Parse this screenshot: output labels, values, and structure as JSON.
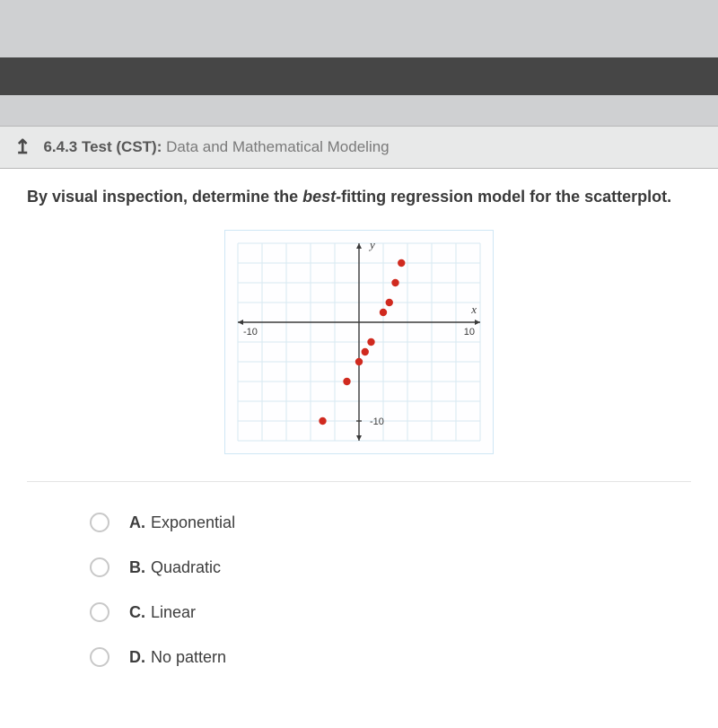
{
  "header": {
    "back_icon": "↥",
    "title_bold": "6.4.3  Test (CST):",
    "title_rest": "Data and Mathematical Modeling"
  },
  "question": {
    "prefix": "By visual inspection, determine the ",
    "emph": "best-",
    "suffix": "fitting regression model for the scatterplot."
  },
  "answers": [
    {
      "letter": "A.",
      "text": "Exponential"
    },
    {
      "letter": "B.",
      "text": "Quadratic"
    },
    {
      "letter": "C.",
      "text": "Linear"
    },
    {
      "letter": "D.",
      "text": "No pattern"
    }
  ],
  "chart_data": {
    "type": "scatter",
    "title": "",
    "xlabel": "x",
    "ylabel": "y",
    "xlim": [
      -10,
      10
    ],
    "ylim": [
      -12,
      8
    ],
    "x_ticks": [
      -10,
      10
    ],
    "y_ticks": [
      -10
    ],
    "grid": true,
    "points": [
      {
        "x": -3,
        "y": -10
      },
      {
        "x": -1,
        "y": -6
      },
      {
        "x": 0,
        "y": -4
      },
      {
        "x": 0.5,
        "y": -3
      },
      {
        "x": 1,
        "y": -2
      },
      {
        "x": 2,
        "y": 1
      },
      {
        "x": 2.5,
        "y": 2
      },
      {
        "x": 3,
        "y": 4
      },
      {
        "x": 3.5,
        "y": 6
      }
    ],
    "point_color": "#d02a1f"
  }
}
